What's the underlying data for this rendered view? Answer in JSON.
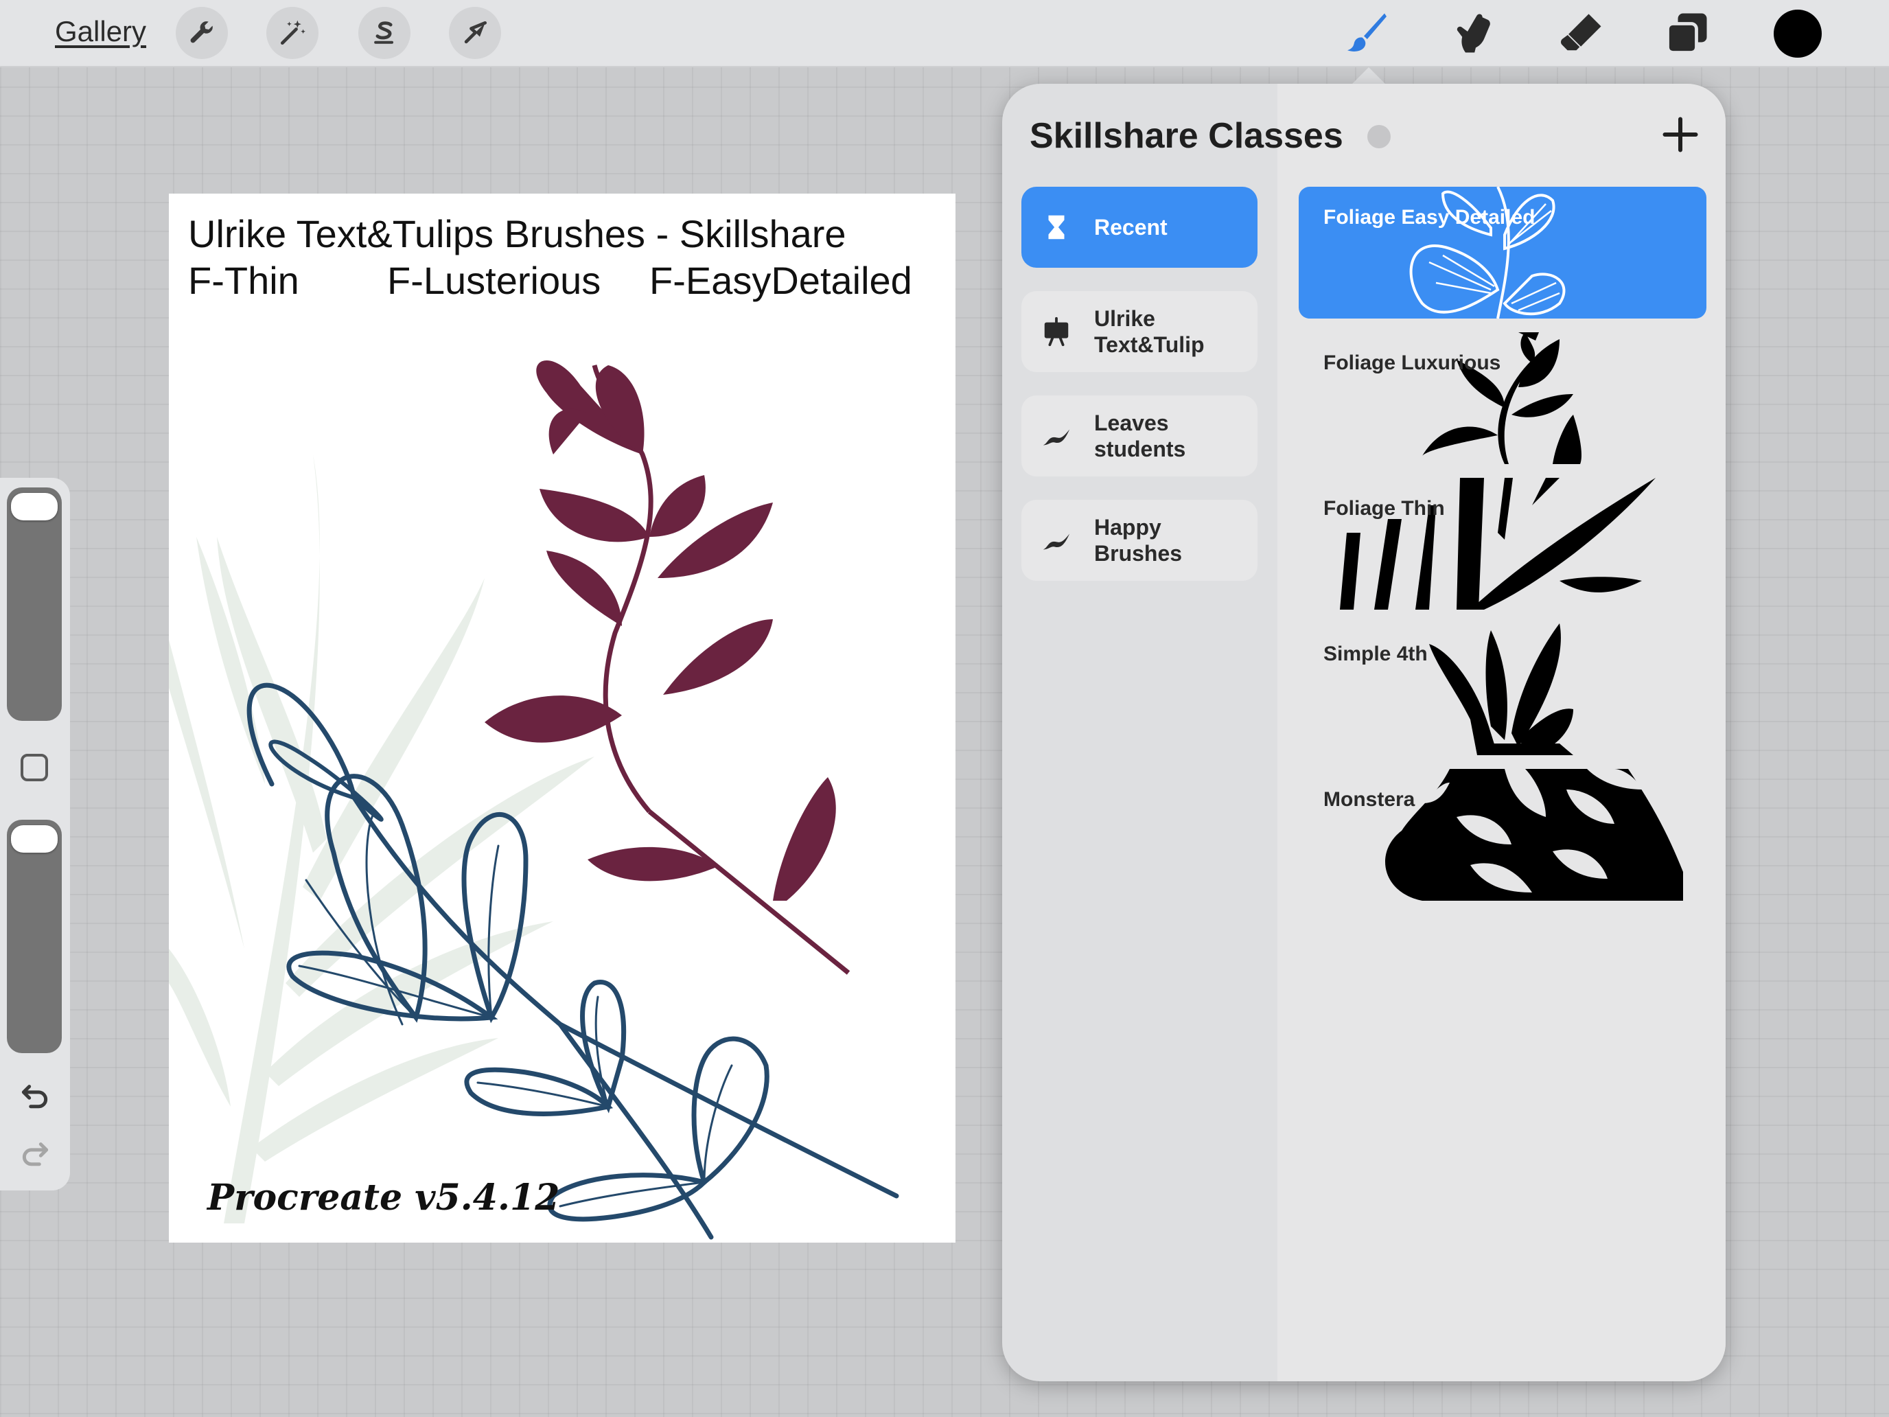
{
  "toolbar": {
    "gallery_label": "Gallery",
    "actions_icon": "wrench-icon",
    "adjustments_icon": "magic-wand-icon",
    "selection_icon": "selection-s-icon",
    "transform_icon": "arrow-cursor-icon",
    "paint_icon": "brush-icon",
    "smudge_icon": "smudge-finger-icon",
    "erase_icon": "eraser-icon",
    "layers_icon": "layers-icon",
    "current_color": "#000000",
    "active_tool_color": "#2f7be0"
  },
  "canvas": {
    "heading_line1": "Ulrike Text&Tulips Brushes - Skillshare",
    "label_thin": "F-Thin",
    "label_lusterious": "F-Lusterious",
    "label_easydetailed": "F-EasyDetailed",
    "footer": "Procreate v5.4.12",
    "colors": {
      "thin": "#e8eee8",
      "lusterious": "#6a2340",
      "easydetailed": "#24496b"
    }
  },
  "brush_library": {
    "title": "Skillshare Classes",
    "add_icon": "plus-icon",
    "accent": "#3b8ef3",
    "sets": [
      {
        "label": "Recent",
        "icon": "hourglass-icon",
        "active": true
      },
      {
        "label": "Ulrike Text&Tulip",
        "icon": "easel-icon",
        "active": false
      },
      {
        "label": "Leaves students",
        "icon": "brush-stroke-icon",
        "active": false
      },
      {
        "label": "Happy Brushes",
        "icon": "brush-stroke-icon",
        "active": false
      }
    ],
    "brushes": [
      {
        "name": "Foliage Easy Detailed",
        "active": true
      },
      {
        "name": "Foliage Luxurious",
        "active": false
      },
      {
        "name": "Foliage Thin",
        "active": false
      },
      {
        "name": "Simple 4th",
        "active": false
      },
      {
        "name": "Monstera",
        "active": false
      }
    ]
  }
}
